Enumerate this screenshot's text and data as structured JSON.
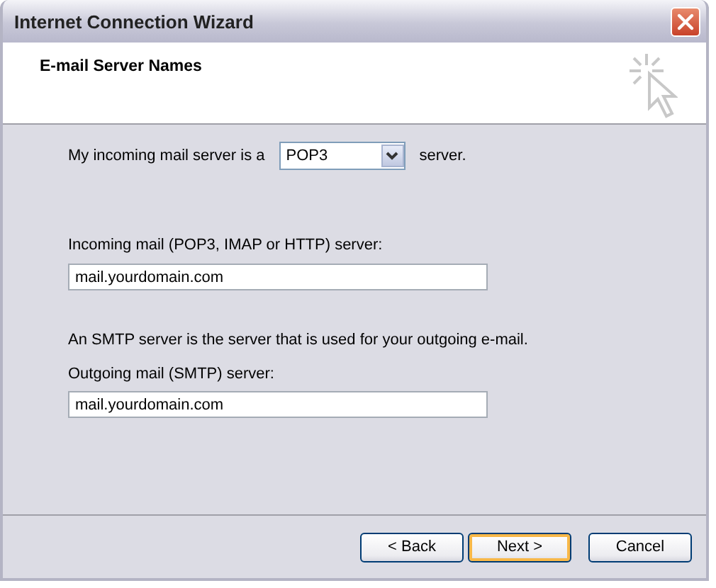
{
  "window": {
    "title": "Internet Connection Wizard"
  },
  "header": {
    "title": "E-mail Server Names"
  },
  "server_type": {
    "prefix": "My incoming mail server is a",
    "value": "POP3",
    "suffix": "server."
  },
  "incoming": {
    "label": "Incoming mail (POP3, IMAP or HTTP) server:",
    "value": "mail.yourdomain.com"
  },
  "smtp_note": "An SMTP server is the server that is used for your outgoing e-mail.",
  "outgoing": {
    "label": "Outgoing mail (SMTP) server:",
    "value": "mail.yourdomain.com"
  },
  "buttons": [
    {
      "label": "< Back",
      "default": false
    },
    {
      "label": "Next >",
      "default": true
    },
    {
      "label": "Cancel",
      "default": false
    }
  ]
}
